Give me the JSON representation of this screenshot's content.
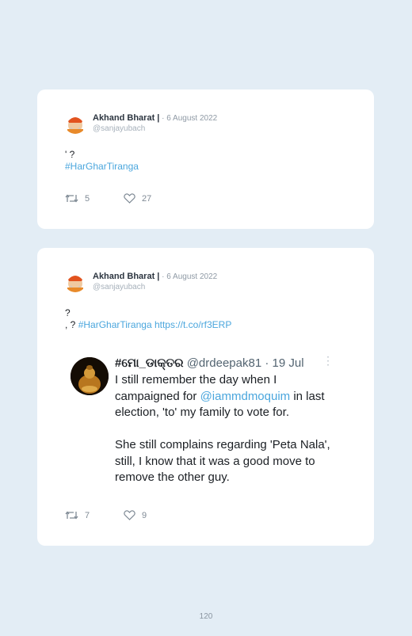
{
  "tweets": [
    {
      "author": "Akhand Bharat |",
      "date": " · 6 August 2022",
      "handle": "@sanjayubach",
      "line1": "' ?",
      "hashtag": "#HarGharTiranga",
      "retweets": "5",
      "likes": "27"
    },
    {
      "author": "Akhand Bharat |",
      "date": " · 6 August 2022",
      "handle": "@sanjayubach",
      "line1": "?",
      "line2_prefix": ", ? ",
      "hashtag": "#HarGharTiranga",
      "url": " https://t.co/rf3ERP",
      "retweets": "7",
      "likes": "9",
      "quoted": {
        "name": "#ମୋ_ଡାକ୍ତର",
        "handle": " @drdeepak81",
        "date": " · 19 Jul",
        "text_a": "I still remember the day when I campaigned for ",
        "mention": "@iammdmoquim",
        "text_b": " in last election, 'to' my family to vote for.",
        "text_c": "She still complains regarding 'Peta Nala', still, I know that it was a good move to remove the other guy."
      }
    }
  ],
  "page_number": "120",
  "icons": {
    "retweet": "retweet-icon",
    "like": "heart-icon",
    "more": "more-icon"
  },
  "colors": {
    "link": "#4aa6dd",
    "background": "#e3edf5",
    "card": "#ffffff"
  }
}
